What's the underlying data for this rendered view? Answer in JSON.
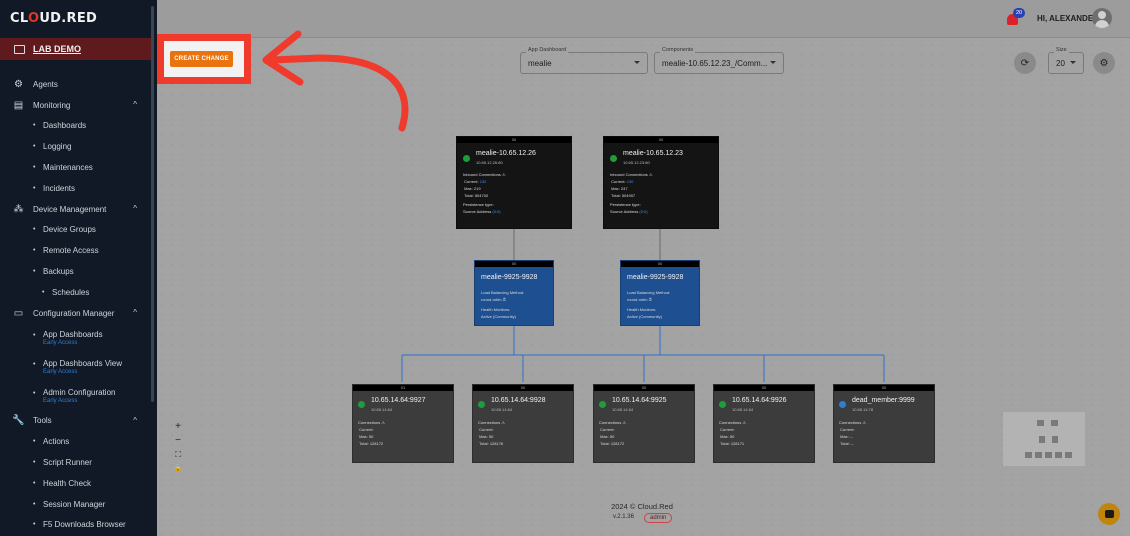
{
  "brand": {
    "logo_left": "CL",
    "logo_o": "O",
    "logo_mid": "UD.",
    "logo_right": "RED",
    "lab": "LAB DEMO"
  },
  "sidebar": {
    "items": [
      {
        "type": "section",
        "label": "Agents",
        "icon": "agents-icon"
      },
      {
        "type": "section",
        "label": "Monitoring",
        "icon": "chart-icon",
        "chev": "^"
      },
      {
        "type": "sub",
        "label": "Dashboards"
      },
      {
        "type": "sub",
        "label": "Logging"
      },
      {
        "type": "sub",
        "label": "Maintenances"
      },
      {
        "type": "sub",
        "label": "Incidents"
      },
      {
        "type": "section",
        "label": "Device Management",
        "icon": "devices-icon",
        "chev": "^"
      },
      {
        "type": "sub",
        "label": "Device Groups"
      },
      {
        "type": "sub",
        "label": "Remote Access"
      },
      {
        "type": "sub",
        "label": "Backups"
      },
      {
        "type": "sub2",
        "label": "Schedules"
      },
      {
        "type": "section",
        "label": "Configuration Manager",
        "icon": "monitor-icon",
        "chev": "^"
      },
      {
        "type": "tall",
        "label": "App Dashboards",
        "early": "Early Access"
      },
      {
        "type": "tall",
        "label": "App Dashboards View",
        "early": "Early Access"
      },
      {
        "type": "tall",
        "label": "Admin Configuration",
        "early": "Early Access"
      },
      {
        "type": "section",
        "label": "Tools",
        "icon": "wrench-icon",
        "chev": "^"
      },
      {
        "type": "sub",
        "label": "Actions"
      },
      {
        "type": "sub",
        "label": "Script Runner"
      },
      {
        "type": "sub",
        "label": "Health Check"
      },
      {
        "type": "sub",
        "label": "Session Manager"
      },
      {
        "type": "sub",
        "label": "F5 Downloads Browser"
      }
    ]
  },
  "header": {
    "notifications": "20",
    "user_greeting": "HI, ALEXANDER"
  },
  "toolbar": {
    "create_change": "CREATE CHANGE",
    "app_dashboard_label": "App Dashboard",
    "app_dashboard_value": "mealie",
    "components_label": "Components",
    "components_value": "mealie-10.65.12.23_/Comm...",
    "size_label": "Size",
    "size_value": "20"
  },
  "nodes": {
    "vs1": {
      "bar": "00",
      "title": "mealie-10.65.12.26",
      "sub": "10.65.12.26:80",
      "inbound": "Inbound Connections",
      "current_label": "Current:",
      "current": "132",
      "max_label": "Max:",
      "max": "219",
      "total_label": "Total:",
      "total": "504700",
      "persistence": "Persistence type:",
      "source": "Source Address",
      "source_link": "(0:0)"
    },
    "vs2": {
      "bar": "00",
      "title": "mealie-10.65.12.23",
      "sub": "10.65.12.23:80",
      "inbound": "Inbound Connections",
      "current_label": "Current:",
      "current": "130",
      "max_label": "Max:",
      "max": "247",
      "total_label": "Total:",
      "total": "504907",
      "persistence": "Persistence type:",
      "source": "Source Address",
      "source_link": "(0:0)"
    },
    "pool1": {
      "bar": "00",
      "title": "mealie-9925-9928",
      "lb": "Load Balancing Method:",
      "lb_value": "round-robin",
      "hm": "Health Monitors:",
      "hm_value": "Active (Community)"
    },
    "pool2": {
      "bar": "00",
      "title": "mealie-9925-9928",
      "lb": "Load Balancing Method:",
      "lb_value": "round-robin",
      "hm": "Health Monitors:",
      "hm_value": "Active (Community)"
    },
    "members": [
      {
        "bar": "01",
        "title": "10.65.14.64:9927",
        "sub": "10.65.14.64",
        "conn": "Connections",
        "current_label": "Current:",
        "current": "",
        "max_label": "Max:",
        "max": "50",
        "total_label": "Total:",
        "total": "128172"
      },
      {
        "bar": "00",
        "title": "10.65.14.64:9928",
        "sub": "10.65.14.64",
        "conn": "Connections",
        "current_label": "Current:",
        "current": "",
        "max_label": "Max:",
        "max": "50",
        "total_label": "Total:",
        "total": "128176"
      },
      {
        "bar": "00",
        "title": "10.65.14.64:9925",
        "sub": "10.65.14.64",
        "conn": "Connections",
        "current_label": "Current:",
        "current": "",
        "max_label": "Max:",
        "max": "50",
        "total_label": "Total:",
        "total": "128172"
      },
      {
        "bar": "00",
        "title": "10.65.14.64:9926",
        "sub": "10.65.14.64",
        "conn": "Connections",
        "current_label": "Current:",
        "current": "",
        "max_label": "Max:",
        "max": "50",
        "total_label": "Total:",
        "total": "128171"
      },
      {
        "bar": "00",
        "title": "dead_member:9999",
        "sub": "10.65.14.78",
        "conn": "Connections",
        "current_label": "Current:",
        "current": "",
        "max_label": "Max:",
        "max": "--",
        "total_label": "Total:",
        "total": "--"
      }
    ]
  },
  "zoom": {
    "plus": "+",
    "minus": "−",
    "fit": "⛶",
    "lock": "🔒"
  },
  "footer": {
    "copyright": "2024  © Cloud.Red",
    "version": "v.2.1.36",
    "role": "admin"
  },
  "colors": {
    "accent_red": "#ef3a2c",
    "create_orange": "#e8730f",
    "node_blue": "#1d4f91",
    "status_green": "#1f9d3a",
    "status_blue": "#2d7fd3"
  }
}
